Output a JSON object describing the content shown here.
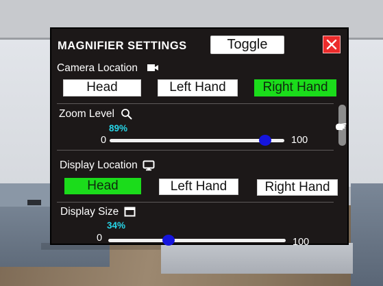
{
  "panel": {
    "title": "MAGNIFIER SETTINGS",
    "toggle_label": "Toggle",
    "close_icon": "close-x-icon"
  },
  "camera_location": {
    "label": "Camera Location",
    "icon": "video-camera-icon",
    "options": [
      "Head",
      "Left Hand",
      "Right Hand"
    ],
    "selected": "Right Hand"
  },
  "zoom_level": {
    "label": "Zoom Level",
    "icon": "magnifier-icon",
    "percent_text": "89%",
    "value_fraction": 0.89,
    "min_label": "0",
    "max_label": "100"
  },
  "display_location": {
    "label": "Display Location",
    "icon": "monitor-icon",
    "options": [
      "Head",
      "Left Hand",
      "Right Hand"
    ],
    "selected": "Head"
  },
  "display_size": {
    "label": "Display Size",
    "icon": "window-icon",
    "percent_text": "34%",
    "value_fraction": 0.34,
    "min_label": "0",
    "max_label": "100"
  },
  "colors": {
    "panel_bg": "#1c1818",
    "selected_button": "#1bdc1b",
    "close_button": "#ec2b2b",
    "percent_text": "#27d6e8",
    "slider_knob": "#1515dd"
  }
}
